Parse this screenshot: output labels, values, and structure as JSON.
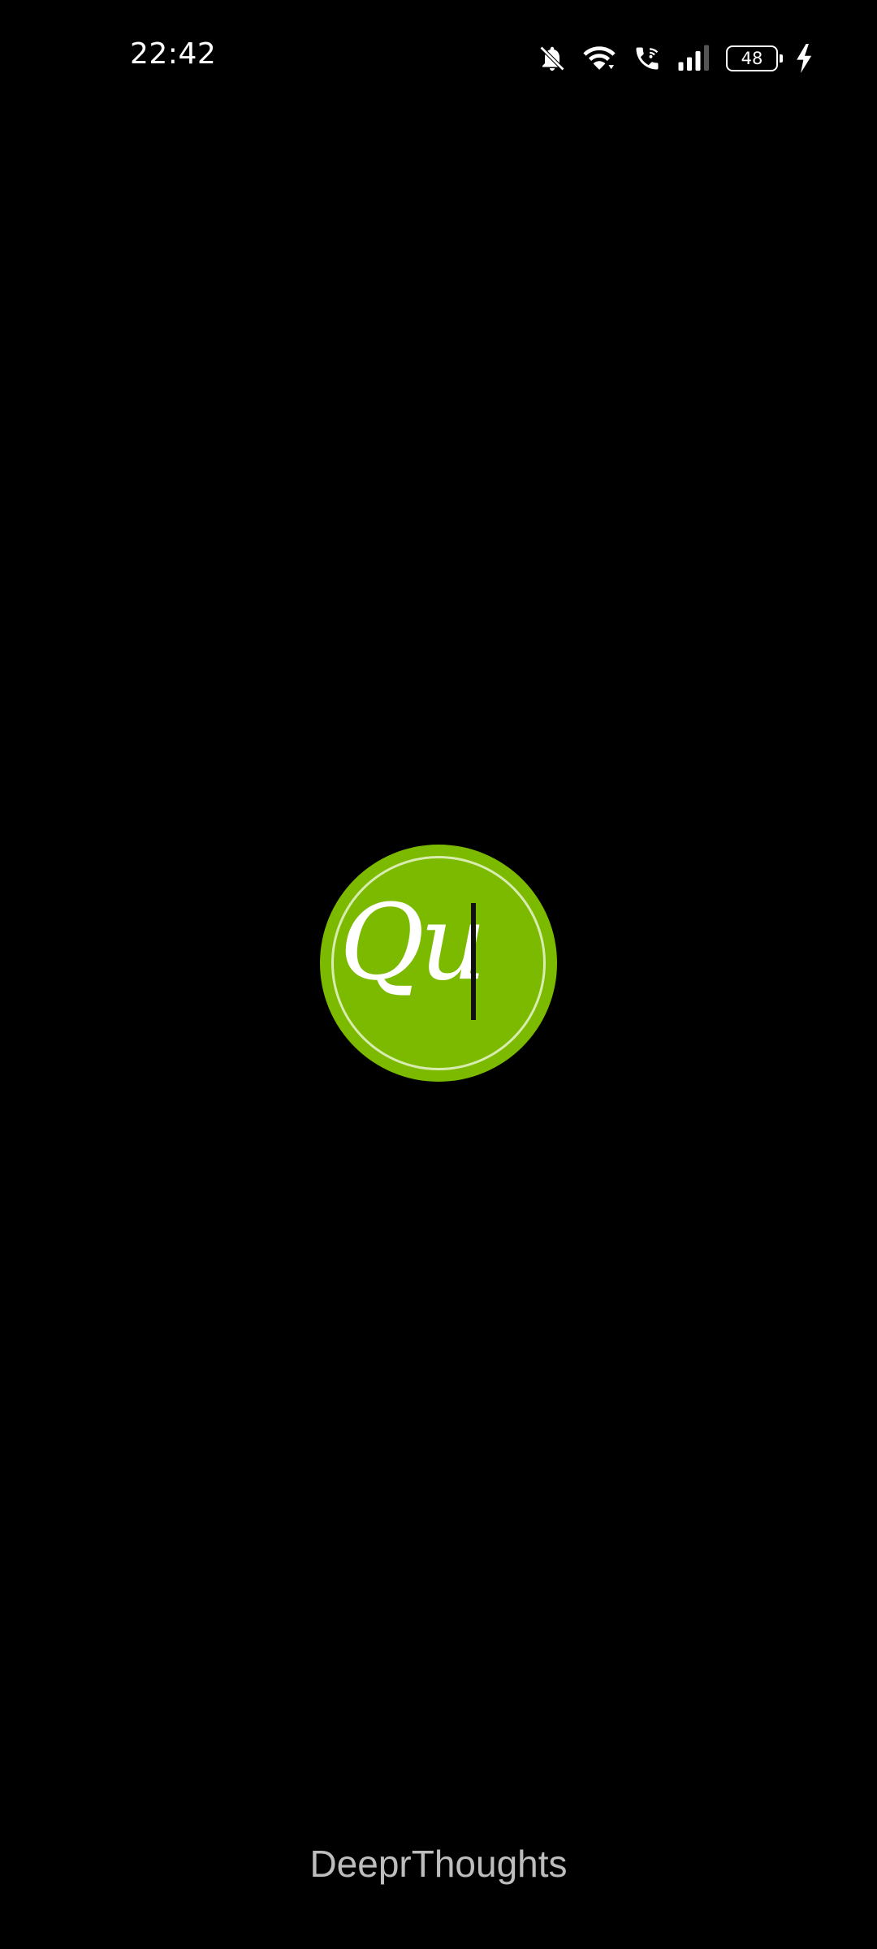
{
  "status_bar": {
    "time": "22:42",
    "battery_level": "48",
    "icons": [
      "bell-muted-icon",
      "wifi-icon",
      "wifi-calling-icon",
      "signal-icon",
      "battery-icon",
      "charging-icon"
    ]
  },
  "splash": {
    "logo_text": "Qu",
    "logo_color": "#7cba00",
    "brand_name": "DeeprThoughts"
  }
}
